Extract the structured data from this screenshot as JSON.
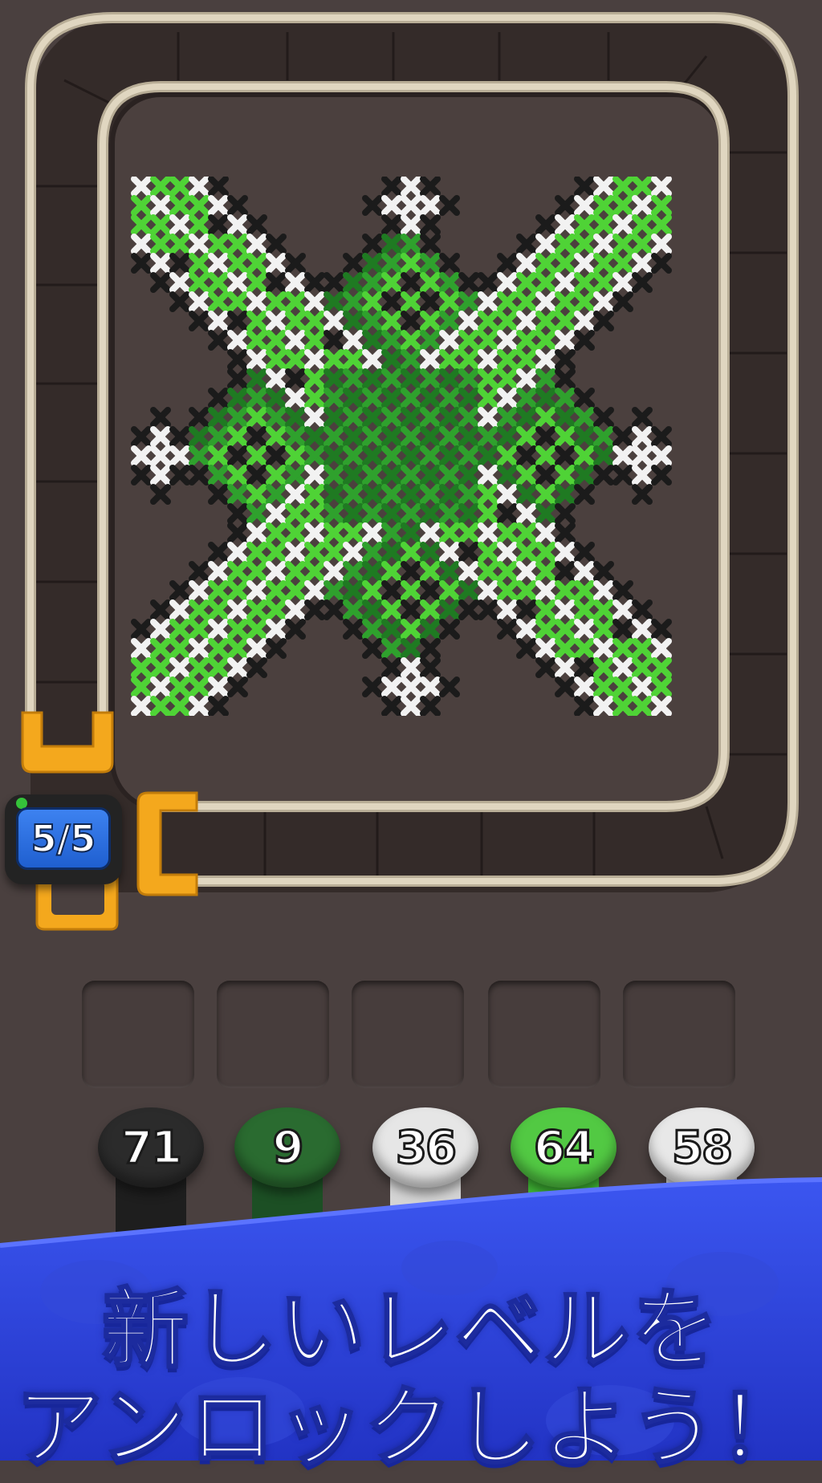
{
  "board": {
    "frame_color": "#3a312f",
    "track_rail_color": "#d8cdb5",
    "clamp_color": "#f4a81d"
  },
  "counter": {
    "text": "5/5"
  },
  "queue_slots": {
    "count": 5
  },
  "spools": [
    {
      "number": "71",
      "color": "#1e1e1e",
      "cap_color": "#2b2b2b"
    },
    {
      "number": "9",
      "color": "#1c4f24",
      "cap_color": "#2a6b30"
    },
    {
      "number": "36",
      "color": "#d4d4d4",
      "cap_color": "#e6e6e6"
    },
    {
      "number": "64",
      "color": "#3fb534",
      "cap_color": "#52c943"
    },
    {
      "number": "58",
      "color": "#d4d4d4",
      "cap_color": "#e8e8e8"
    }
  ],
  "promo": {
    "line1": "新しいレベルを",
    "line2": "アンロックしよう！",
    "banner_color": "#2b3fd8"
  },
  "artwork": {
    "colors": {
      "black": "#1b1b1b",
      "white": "#f2f2f2",
      "light_green": "#4fd336",
      "dark_green": "#1f7a22",
      "mid_green": "#2fa12d"
    }
  }
}
